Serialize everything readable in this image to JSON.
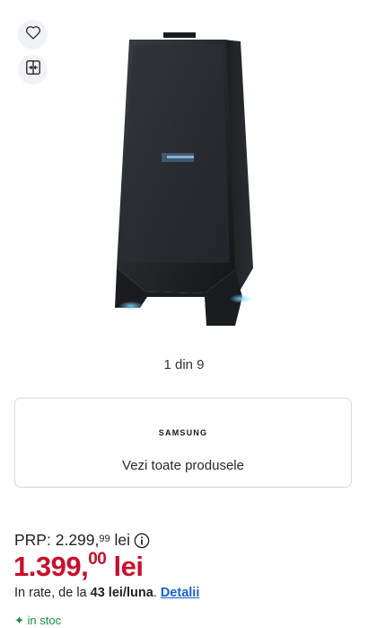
{
  "gallery": {
    "counter": "1 din 9"
  },
  "brand_card": {
    "logo_text": "SAMSUNG",
    "link_label": "Vezi toate produsele"
  },
  "pricing": {
    "prp_label": "PRP:",
    "prp_integer": "2.299,",
    "prp_decimals": "99",
    "prp_currency": "lei",
    "price_integer": "1.399,",
    "price_decimals": "00",
    "price_currency": "lei",
    "installments_prefix": "In rate, de la",
    "installments_amount": "43 lei/luna",
    "installments_suffix": ".",
    "installments_link": "Detalii"
  },
  "stock": {
    "icon": "✦",
    "label": "in stoc"
  },
  "icons": {
    "favorite": "heart-icon",
    "compare": "compare-icon",
    "info": "info-icon"
  },
  "colors": {
    "price_red": "#c8102e",
    "link_blue": "#1a5fd0",
    "stock_green": "#1b8f3a",
    "button_bg": "#f1f2f6"
  }
}
